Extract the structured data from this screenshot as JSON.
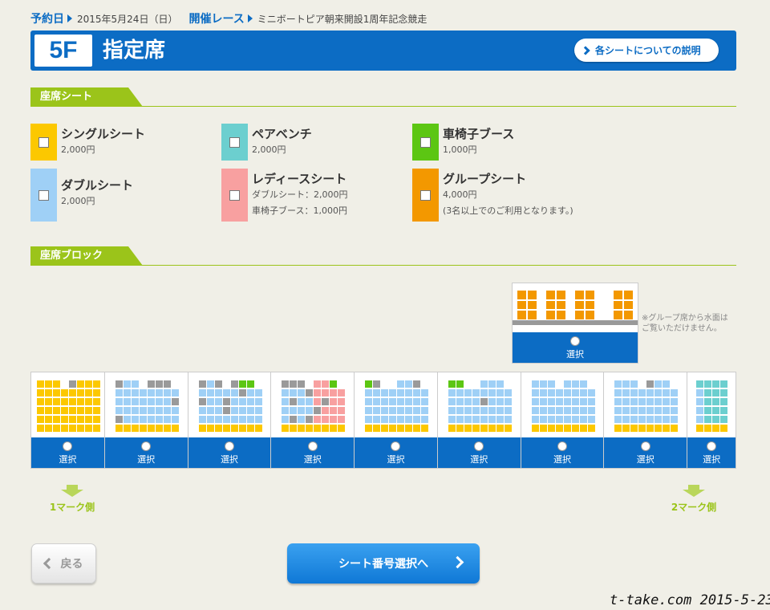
{
  "breadcrumb": {
    "date_label": "予約日",
    "date_value": "2015年5月24日（日）",
    "race_label": "開催レース",
    "race_value": "ミニボートピア朝来開設1周年記念競走"
  },
  "header": {
    "floor": "5F",
    "title": "指定席",
    "explain_button": "各シートについての説明"
  },
  "seat_section": {
    "heading": "座席シート",
    "types": [
      {
        "name": "シングルシート",
        "lines": [
          "2,000円"
        ],
        "color": "#fcc800"
      },
      {
        "name": "ダブルシート",
        "lines": [
          "2,000円"
        ],
        "color": "#9fd0f6"
      },
      {
        "name": "ペアベンチ",
        "lines": [
          "2,000円"
        ],
        "color": "#6ccfcf"
      },
      {
        "name": "レディースシート",
        "lines": [
          "ダブルシート：2,000円",
          "車椅子ブース：1,000円"
        ],
        "color": "#f8a0a0"
      },
      {
        "name": "車椅子ブース",
        "lines": [
          "1,000円"
        ],
        "color": "#5cc613"
      },
      {
        "name": "グループシート",
        "lines": [
          "4,000円",
          "(3名以上でのご利用となります。)"
        ],
        "color": "#f39800"
      }
    ]
  },
  "block_section": {
    "heading": "座席ブロック",
    "group_booth": {
      "select_label": "選択"
    },
    "group_note": "※グループ席から水面は\nご覧いただけません。",
    "blocks": [
      {
        "select_label": "選択",
        "rows": [
          "YYY.GYYY",
          "YYYYYYYY",
          "YYYYYYYY",
          "YYYYYYYY",
          "YYYYYYYY",
          "YYYYYYYY"
        ]
      },
      {
        "select_label": "選択",
        "rows": [
          "GBB.GGG.",
          "BBBBBBBB",
          "BBBBBBBG",
          "BBBBBBBB",
          "GBBBBBBB",
          "YYYYYYYY"
        ]
      },
      {
        "select_label": "選択",
        "rows": [
          "GBG.GWW.",
          "BBBBBGBB",
          "GBBGBBBB",
          "BBBGBBBB",
          "BBBBBBBB",
          "YYYYYYYY"
        ]
      },
      {
        "select_label": "選択",
        "rows": [
          "GGG.PPW.",
          "BBBGPPPP",
          "BGBBPGPP",
          "BBBBGPPP",
          "BGBGPPPP",
          "YYYYYYYY"
        ]
      },
      {
        "select_label": "選択",
        "rows": [
          "WG..BBG.",
          "BBBBBBBB",
          "BBBBBBBB",
          "BBBBBBBB",
          "BBBBBBBB",
          "YYYYYYYY"
        ]
      },
      {
        "select_label": "選択",
        "rows": [
          "WW..BBB.",
          "BBBBBBBB",
          "BBBBGBBB",
          "BBBBBBBB",
          "BBBBBBBB",
          "YYYYYYYY"
        ]
      },
      {
        "select_label": "選択",
        "rows": [
          "BBB.BBB.",
          "BBBBBBBB",
          "BBBBBBBB",
          "BBBBBBBB",
          "BBBBBBBB",
          "YYYYYYYY"
        ]
      },
      {
        "select_label": "選択",
        "rows": [
          "BBB.GBB.",
          "BBBBBBBB",
          "BBBBBBBB",
          "BBBBBBBB",
          "BBBBBBBB",
          "YYYYYYYY"
        ]
      },
      {
        "select_label": "選択",
        "rows": [
          "TTTT",
          "BTTT",
          "BTTT",
          "BTTT",
          "BTTT",
          "YYYY"
        ]
      }
    ],
    "mark_left": "1マーク側",
    "mark_right": "2マーク側"
  },
  "nav": {
    "back": "戻る",
    "next": "シート番号選択へ"
  },
  "watermark": "t-take.com 2015-5-23",
  "seat_colors": {
    "Y": "#fcc800",
    "B": "#9fd0f6",
    "G": "#9a9a9a",
    "W": "#5cc613",
    "P": "#f8a0a0",
    "T": "#6ccfcf",
    "O": "#f39800"
  }
}
